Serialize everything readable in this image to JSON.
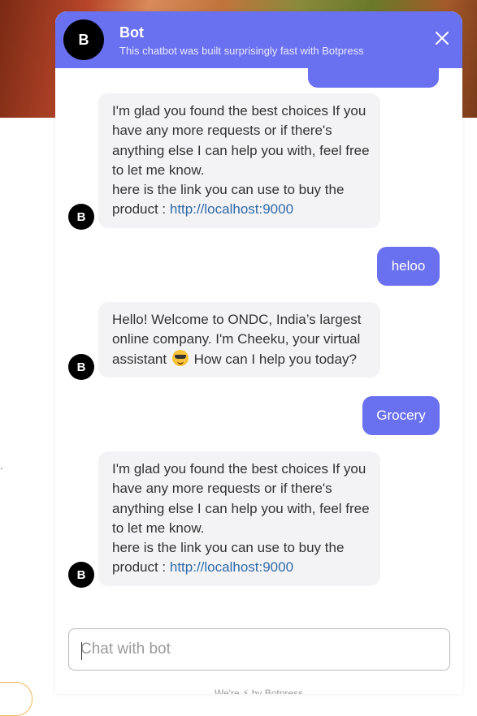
{
  "header": {
    "avatar_letter": "B",
    "title": "Bot",
    "subtitle": "This chatbot was built surprisingly fast with Botpress"
  },
  "messages": [
    {
      "sender": "bot",
      "lines": [
        "I'm glad you found the best choices If you",
        "have any more requests or if there's",
        "anything else I can help you with, feel free",
        "to let me know.",
        "here is the link you can use to buy the"
      ],
      "link_prefix": "product : ",
      "link_text": "http://localhost:9000",
      "avatar_letter": "B"
    },
    {
      "sender": "user",
      "text": "heloo"
    },
    {
      "sender": "bot",
      "lines": [
        "Hello! Welcome to ONDC, India’s largest",
        "online company. I'm Cheeku, your virtual"
      ],
      "line3_before": "assistant",
      "emoji": "smiling-face-with-sunglasses",
      "line3_after": "How can I help you today?",
      "avatar_letter": "B"
    },
    {
      "sender": "user",
      "text": "Grocery"
    },
    {
      "sender": "bot",
      "lines": [
        "I'm glad you found the best choices If you",
        "have any more requests or if there's",
        "anything else I can help you with, feel free",
        "to let me know.",
        "here is the link you can use to buy the"
      ],
      "link_prefix": "product : ",
      "link_text": "http://localhost:9000",
      "avatar_letter": "B"
    }
  ],
  "composer": {
    "placeholder": "Chat with bot"
  },
  "footer": {
    "text": "We're ⚡ by Botpress"
  },
  "colors": {
    "accent": "#6a71f0",
    "bot_bubble": "#f3f3f5",
    "link": "#2f6aa8"
  }
}
